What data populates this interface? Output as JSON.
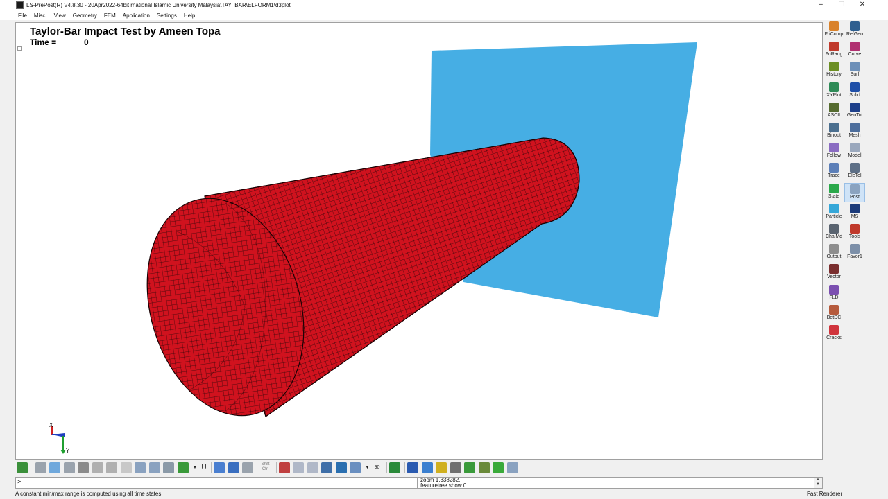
{
  "window": {
    "title": "LS-PrePost(R) V4.8.30 - 20Apr2022-64bit rnational Islamic University Malaysia\\TAY_BAR\\ELFORM1\\d3plot",
    "minimize_glyph": "–",
    "maximize_glyph": "❐",
    "close_glyph": "✕"
  },
  "menu": {
    "items": [
      {
        "label": "File"
      },
      {
        "label": "Misc."
      },
      {
        "label": "View"
      },
      {
        "label": "Geometry"
      },
      {
        "label": "FEM"
      },
      {
        "label": "Application"
      },
      {
        "label": "Settings"
      },
      {
        "label": "Help"
      }
    ]
  },
  "viewport": {
    "title": "Taylor-Bar Impact Test by Ameen Topa",
    "time_label": "Time =",
    "time_value": "0",
    "bar_color": "#d0121e",
    "plate_color": "#46aee4",
    "triad_labels": {
      "x": "X",
      "y": "Y"
    }
  },
  "right_toolbar": {
    "col1": [
      {
        "label": "FriComp",
        "icon": "fricomp-icon",
        "color": "#d9822b"
      },
      {
        "label": "FriRang",
        "icon": "frirang-icon",
        "color": "#c0392b"
      },
      {
        "label": "History",
        "icon": "history-icon",
        "color": "#6b8e23"
      },
      {
        "label": "XYPlot",
        "icon": "xyplot-icon",
        "color": "#2e8b57"
      },
      {
        "label": "ASCII",
        "icon": "ascii-icon",
        "color": "#556b2f"
      },
      {
        "label": "Binout",
        "icon": "binout-icon",
        "color": "#4b6f8f"
      },
      {
        "label": "Follow",
        "icon": "follow-icon",
        "color": "#8a6cc2"
      },
      {
        "label": "Trace",
        "icon": "trace-icon",
        "color": "#5c7fb8"
      },
      {
        "label": "State",
        "icon": "state-icon",
        "color": "#2aa84a"
      },
      {
        "label": "Particle",
        "icon": "particle-icon",
        "color": "#35a7d8"
      },
      {
        "label": "ChaiMd",
        "icon": "chaimd-icon",
        "color": "#5a6470"
      },
      {
        "label": "Output",
        "icon": "output-icon",
        "color": "#8d8d8d"
      },
      {
        "label": "Vector",
        "icon": "vector-icon",
        "color": "#7a2f2f"
      },
      {
        "label": "FLD",
        "icon": "fld-icon",
        "color": "#7b4fb0"
      },
      {
        "label": "BotDC",
        "icon": "botdc-icon",
        "color": "#b55a3c"
      },
      {
        "label": "Cracks",
        "icon": "cracks-icon",
        "color": "#d0343c"
      }
    ],
    "col2": [
      {
        "label": "RefGeo",
        "icon": "refgeo-icon",
        "color": "#2f5f8f"
      },
      {
        "label": "Curve",
        "icon": "curve-icon",
        "color": "#b03070"
      },
      {
        "label": "Surf",
        "icon": "surf-icon",
        "color": "#6c8fb8"
      },
      {
        "label": "Solid",
        "icon": "solid-icon",
        "color": "#1f4fa8"
      },
      {
        "label": "GeoTol",
        "icon": "geotol-icon",
        "color": "#1d3f8a"
      },
      {
        "label": "Mesh",
        "icon": "mesh-icon",
        "color": "#4d6e9c"
      },
      {
        "label": "Model",
        "icon": "model-icon",
        "color": "#9aa8bd"
      },
      {
        "label": "EleTol",
        "icon": "eletol-icon",
        "color": "#5d6f86"
      },
      {
        "label": "Post",
        "icon": "post-icon",
        "color": "#8aa3c0",
        "active": true
      },
      {
        "label": "MS",
        "icon": "ms-icon",
        "color": "#1a3a7a"
      },
      {
        "label": "Tools",
        "icon": "tools-icon",
        "color": "#c0392b"
      },
      {
        "label": "Favor1",
        "icon": "favor1-icon",
        "color": "#7c8fa8"
      }
    ]
  },
  "bottom_toolbar": {
    "shift_label": "Shift",
    "ctrl_label": "Ctrl",
    "angle_label": "90",
    "dropdown_glyph": "▼",
    "u_label": "U"
  },
  "command": {
    "prompt": ">",
    "output_lines": [
      "zoom 1.338282,",
      "featuretree show 0"
    ],
    "scroll_up": "▲",
    "scroll_down": "▼"
  },
  "status": {
    "message": "A constant min/max range is computed using all time states",
    "renderer": "Fast Renderer"
  }
}
